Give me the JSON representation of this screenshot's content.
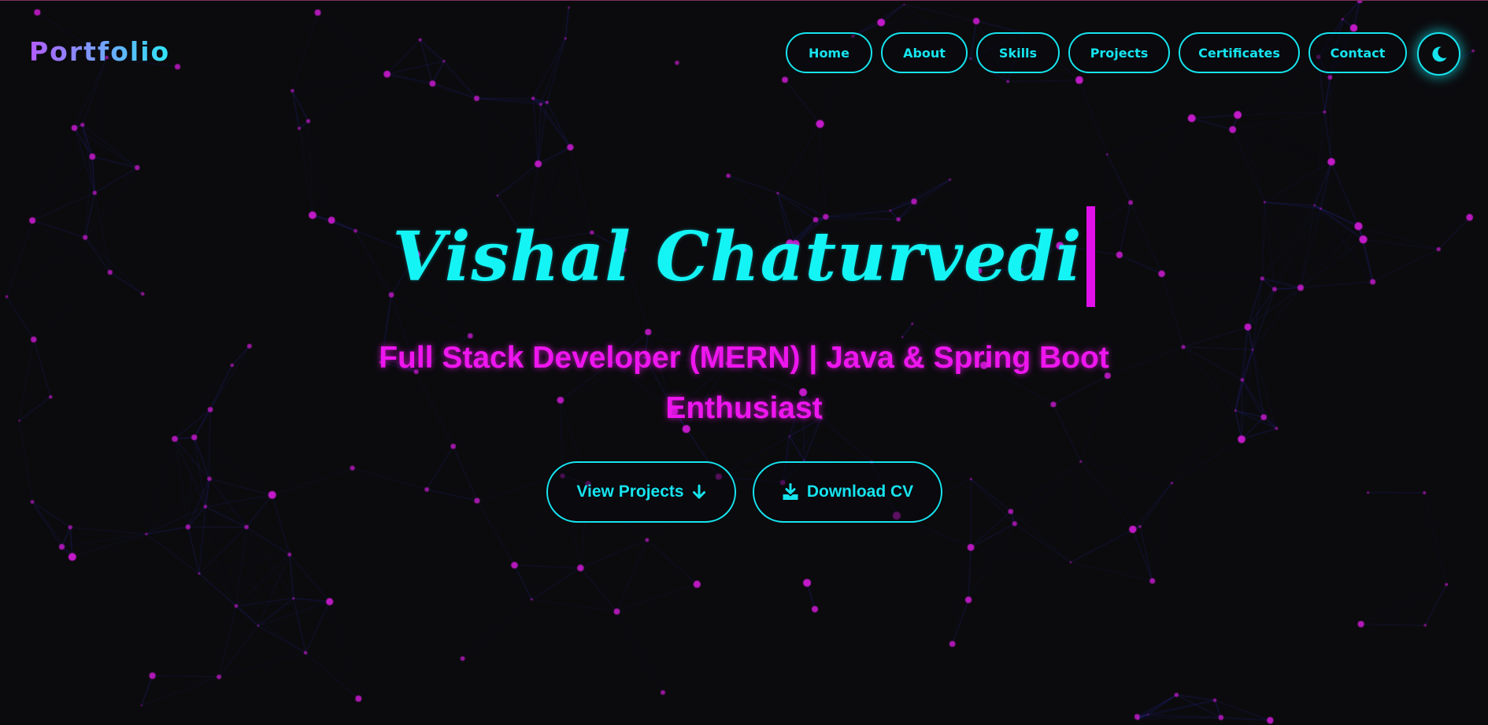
{
  "brand": {
    "label": "Portfolio"
  },
  "nav": {
    "items": [
      {
        "label": "Home"
      },
      {
        "label": "About"
      },
      {
        "label": "Skills"
      },
      {
        "label": "Projects"
      },
      {
        "label": "Certificates"
      },
      {
        "label": "Contact"
      }
    ],
    "theme_toggle_icon": "moon-icon"
  },
  "hero": {
    "name": "Vishal Chaturvedi",
    "subtitle_line1": "Full Stack Developer (MERN) | Java & Spring Boot",
    "subtitle_line2": "Enthusiast",
    "buttons": {
      "view_projects": {
        "label": "View Projects",
        "icon": "arrow-down-icon"
      },
      "download_cv": {
        "label": "Download CV",
        "icon": "download-icon"
      }
    }
  },
  "colors": {
    "background": "#0b0b0e",
    "accent_cyan": "#16e4ee",
    "accent_magenta": "#ee16ee",
    "particle_node": "#c21ac8",
    "particle_link": "#1c1c8c"
  }
}
